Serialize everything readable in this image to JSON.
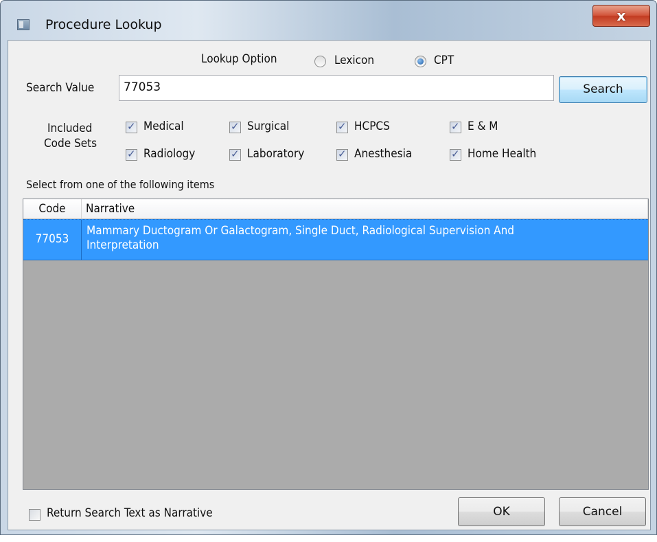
{
  "window": {
    "title": "Procedure Lookup",
    "close_label": "x"
  },
  "lookup": {
    "label": "Lookup Option",
    "options": [
      {
        "label": "Lexicon",
        "selected": false
      },
      {
        "label": "CPT",
        "selected": true
      }
    ]
  },
  "search": {
    "label": "Search Value",
    "value": "77053",
    "button_label": "Search"
  },
  "code_sets": {
    "label_line1": "Included",
    "label_line2": "Code Sets",
    "items": [
      {
        "label": "Medical",
        "checked": true
      },
      {
        "label": "Surgical",
        "checked": true
      },
      {
        "label": "HCPCS",
        "checked": true
      },
      {
        "label": "E & M",
        "checked": true
      },
      {
        "label": "Radiology",
        "checked": true
      },
      {
        "label": "Laboratory",
        "checked": true
      },
      {
        "label": "Anesthesia",
        "checked": true
      },
      {
        "label": "Home Health",
        "checked": true
      }
    ]
  },
  "results": {
    "prompt": "Select from one of the following items",
    "columns": [
      "Code",
      "Narrative"
    ],
    "rows": [
      {
        "code": "77053",
        "narrative_line1": "Mammary Ductogram Or Galactogram, Single Duct, Radiological Supervision And",
        "narrative_line2": "Interpretation",
        "selected": true
      }
    ]
  },
  "footer": {
    "return_text_label": "Return Search Text as Narrative",
    "return_text_checked": false,
    "ok_label": "OK",
    "cancel_label": "Cancel"
  },
  "colors": {
    "selection": "#3399ff",
    "grid_background": "#ababab",
    "dialog_background": "#f0f0f0",
    "close_button": "#c8452a"
  }
}
